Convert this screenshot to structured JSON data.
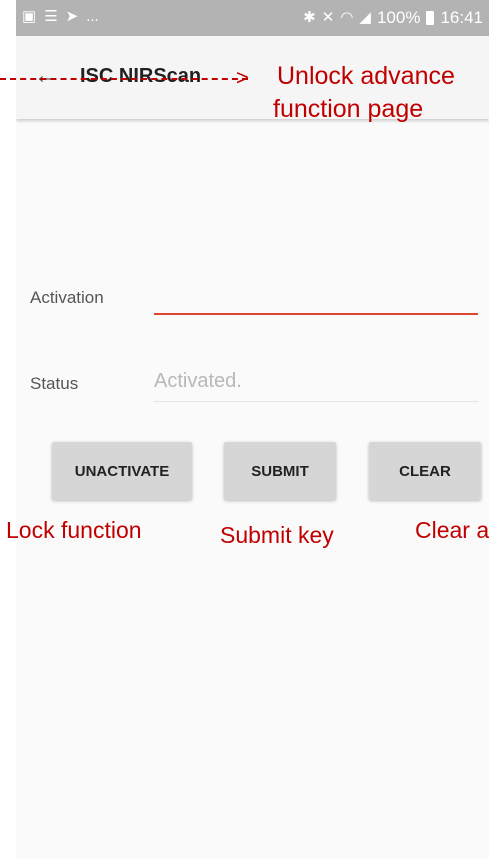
{
  "status_bar": {
    "left_icons": [
      "image-icon",
      "list-icon",
      "send-icon"
    ],
    "overflow": "...",
    "battery_percent": "100%",
    "time": "16:41"
  },
  "app_bar": {
    "back_glyph": "←",
    "title": "ISC NIRScan"
  },
  "form": {
    "activation_label": "Activation",
    "activation_value": "",
    "status_label": "Status",
    "status_value": "Activated."
  },
  "buttons": {
    "unactivate": "UNACTIVATE",
    "submit": "SUBMIT",
    "clear": "CLEAR"
  },
  "annotations": {
    "title_note_line1": "Unlock advance",
    "title_note_line2": "function  page",
    "unactivate_note": "Lock function",
    "submit_note": "Submit key",
    "clear_note": "Clear a"
  },
  "colors": {
    "annotation": "#c00000",
    "input_accent": "#e0452f",
    "status_bar": "#b3b3b3",
    "button": "#d6d6d6"
  }
}
